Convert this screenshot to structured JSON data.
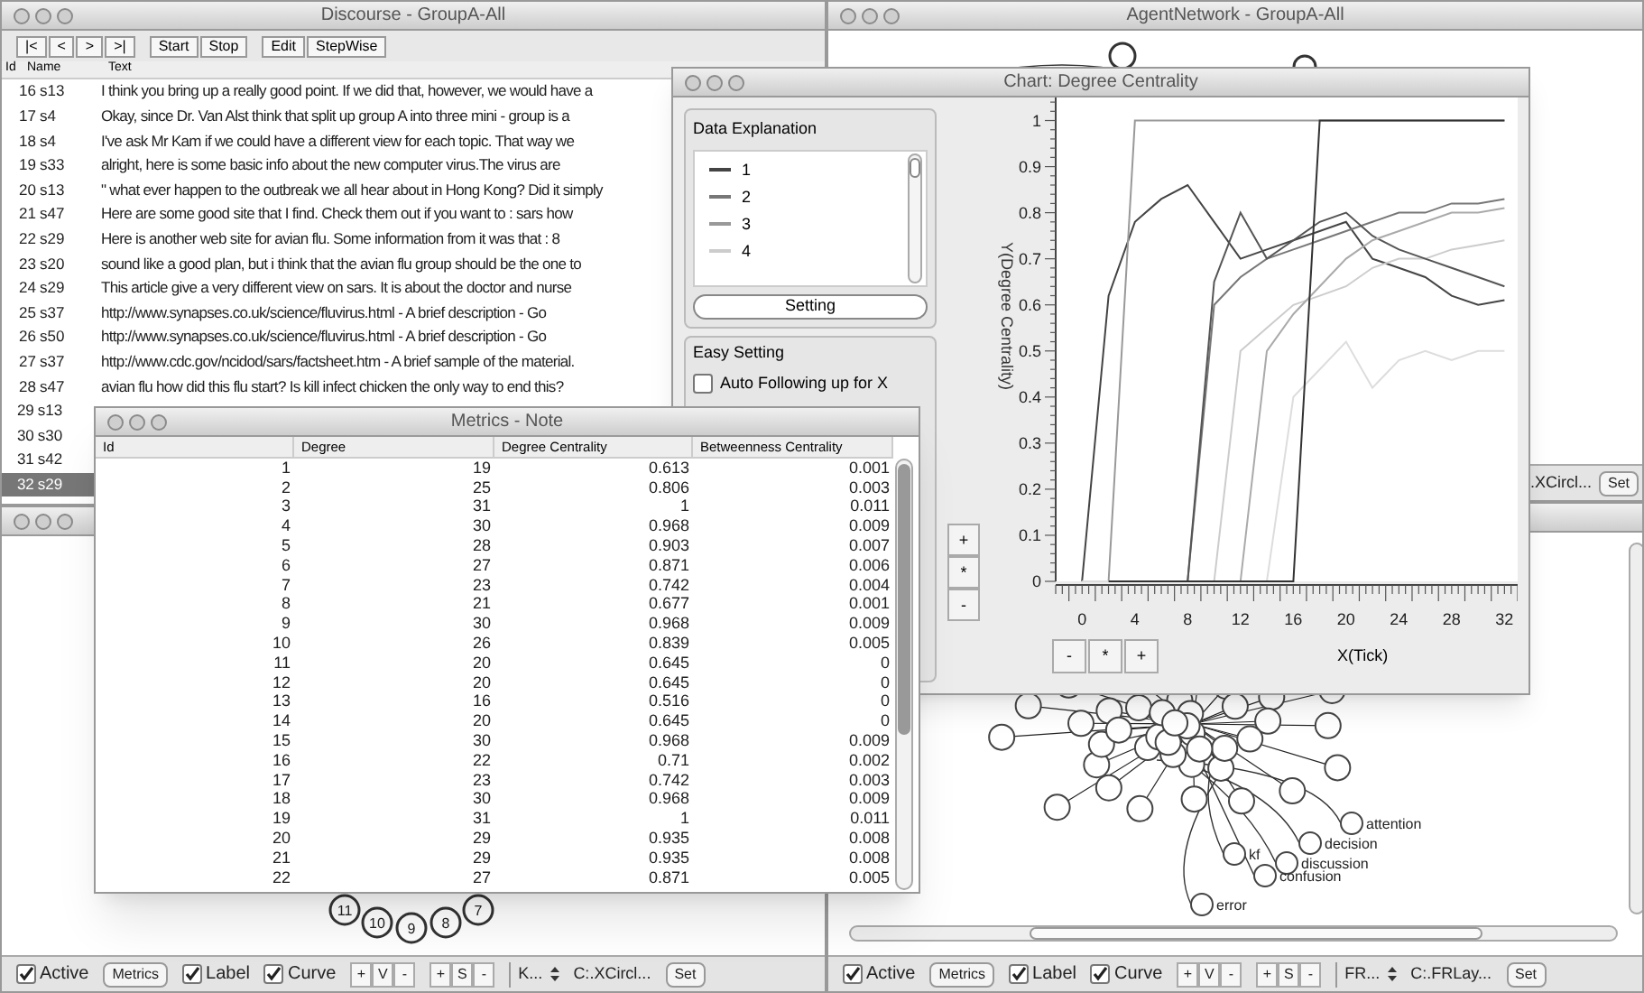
{
  "discourse": {
    "title": "Discourse - GroupA-All",
    "toolbar_groups": [
      [
        "|<",
        "<",
        ">",
        ">|"
      ],
      [
        "Start",
        "Stop"
      ],
      [
        "Edit",
        "StepWise"
      ]
    ],
    "columns": [
      "Id",
      "Name",
      "Text"
    ],
    "rows": [
      {
        "id": "16",
        "name": "s13",
        "text": "I think you bring up a really good point. If we did that, however, we would have a",
        "selected": false
      },
      {
        "id": "17",
        "name": "s4",
        "text": "Okay, since Dr. Van Alst think that split up group A into three mini - group is a",
        "selected": false
      },
      {
        "id": "18",
        "name": "s4",
        "text": "I've ask Mr Kam if we could have a different view for each topic. That way we",
        "selected": false
      },
      {
        "id": "19",
        "name": "s33",
        "text": "alright, here is some basic info about the new computer virus.The virus are",
        "selected": false
      },
      {
        "id": "20",
        "name": "s13",
        "text": "\" what ever happen to the outbreak we all hear about in Hong Kong? Did it simply",
        "selected": false
      },
      {
        "id": "21",
        "name": "s47",
        "text": "Here are some good site that I find. Check them out if you want to : sars how",
        "selected": false
      },
      {
        "id": "22",
        "name": "s29",
        "text": "Here is another web site for avian flu. Some information from it was that : 8",
        "selected": false
      },
      {
        "id": "23",
        "name": "s20",
        "text": "sound like a good plan, but i think that the avian flu group should be  the one to",
        "selected": false
      },
      {
        "id": "24",
        "name": "s29",
        "text": "This article give a very different view on sars. It is about the doctor and nurse",
        "selected": false
      },
      {
        "id": "25",
        "name": "s37",
        "text": "http://www.synapses.co.uk/science/fluvirus.html - A brief description  - Go",
        "selected": false
      },
      {
        "id": "26",
        "name": "s50",
        "text": "http://www.synapses.co.uk/science/fluvirus.html - A brief description  - Go",
        "selected": false
      },
      {
        "id": "27",
        "name": "s37",
        "text": "http://www.cdc.gov/ncidod/sars/factsheet.htm - A brief sample of the material.",
        "selected": false
      },
      {
        "id": "28",
        "name": "s47",
        "text": "avian flu how did this flu start? Is kill infect chicken the only way to end this?",
        "selected": false
      },
      {
        "id": "29",
        "name": "s13",
        "selected": false
      },
      {
        "id": "30",
        "name": "s30",
        "selected": false
      },
      {
        "id": "31",
        "name": "s42",
        "selected": false
      },
      {
        "id": "32",
        "name": "s29",
        "selected": true
      }
    ]
  },
  "left_network": {
    "node_labels": [
      "11",
      "10",
      "9",
      "8",
      "7"
    ],
    "toolbar": [
      {
        "kind": "checkbox",
        "label": "Active",
        "checked": true
      },
      {
        "kind": "button",
        "label": "Metrics"
      },
      {
        "kind": "checkbox",
        "label": "Label",
        "checked": true
      },
      {
        "kind": "checkbox",
        "label": "Curve",
        "checked": true
      },
      {
        "kind": "stepper",
        "parts": [
          "+",
          "V",
          "-"
        ]
      },
      {
        "kind": "stepper",
        "parts": [
          "+",
          "S",
          "-"
        ]
      },
      {
        "kind": "select",
        "label": "K..."
      },
      {
        "kind": "text",
        "label": "C:.XCircl..."
      },
      {
        "kind": "button",
        "label": "Set"
      }
    ]
  },
  "agent_network": {
    "title": "AgentNetwork - GroupA-All",
    "toolbar": [
      {
        "kind": "text",
        "label": ".XCircl..."
      },
      {
        "kind": "button",
        "label": "Set"
      }
    ]
  },
  "right_network": {
    "node_labels": [
      "attention",
      "decision",
      "discussion",
      "confusion",
      "kf",
      "error"
    ],
    "toolbar": [
      {
        "kind": "checkbox",
        "label": "Active",
        "checked": true
      },
      {
        "kind": "button",
        "label": "Metrics"
      },
      {
        "kind": "checkbox",
        "label": "Label",
        "checked": true
      },
      {
        "kind": "checkbox",
        "label": "Curve",
        "checked": true
      },
      {
        "kind": "stepper",
        "parts": [
          "+",
          "V",
          "-"
        ]
      },
      {
        "kind": "stepper",
        "parts": [
          "+",
          "S",
          "-"
        ]
      },
      {
        "kind": "select",
        "label": "FR..."
      },
      {
        "kind": "text",
        "label": "C:.FRLay..."
      },
      {
        "kind": "button",
        "label": "Set"
      }
    ]
  },
  "chart_window": {
    "title": "Chart: Degree Centrality",
    "data_explanation": {
      "title": "Data Explanation",
      "items": [
        {
          "label": "1",
          "color": "#444444"
        },
        {
          "label": "2",
          "color": "#777777"
        },
        {
          "label": "3",
          "color": "#999999"
        },
        {
          "label": "4",
          "color": "#cccccc"
        }
      ],
      "button": "Setting"
    },
    "easy_setting": {
      "title": "Easy Setting",
      "checkbox": {
        "label": "Auto Following up for X",
        "checked": false
      }
    },
    "y_buttons": [
      "+",
      "*",
      "-"
    ],
    "x_buttons": [
      "-",
      "*",
      "+"
    ],
    "chart_data": {
      "type": "line",
      "xlabel": "X(Tick)",
      "ylabel": "Y(Degree Centrality)",
      "x": [
        0,
        2,
        4,
        6,
        8,
        10,
        12,
        14,
        16,
        18,
        20,
        22,
        24,
        26,
        28,
        30,
        32
      ],
      "xlim": [
        -2,
        33
      ],
      "ylim": [
        0,
        1.05
      ],
      "xticks": [
        0,
        4,
        8,
        12,
        16,
        20,
        24,
        28,
        32
      ],
      "yticks": [
        {
          "value": 0,
          "label": "0"
        },
        {
          "value": 0.1,
          "label": "0.1"
        },
        {
          "value": 0.2,
          "label": "0.2"
        },
        {
          "value": 0.3,
          "label": "0.3"
        },
        {
          "value": 0.4,
          "label": "0.4"
        },
        {
          "value": 0.5,
          "label": "0.5"
        },
        {
          "value": 0.6,
          "label": "0.6"
        },
        {
          "value": 0.7,
          "label": "0.7"
        },
        {
          "value": 0.8,
          "label": "0.8"
        },
        {
          "value": 0.9,
          "label": "0.9"
        },
        {
          "value": 1,
          "label": "1"
        }
      ],
      "series": [
        {
          "color": "#444444",
          "values": [
            0,
            0.62,
            0.78,
            0.83,
            0.86,
            0.78,
            0.7,
            0.72,
            0.74,
            0.76,
            0.78,
            0.7,
            0.68,
            0.66,
            0.62,
            0.6,
            0.61
          ]
        },
        {
          "color": "#777777",
          "values": [
            0,
            0,
            0,
            0,
            0,
            0.6,
            0.66,
            0.7,
            0.72,
            0.74,
            0.76,
            0.78,
            0.8,
            0.8,
            0.82,
            0.82,
            0.83
          ]
        },
        {
          "color": "#999999",
          "values": [
            0,
            0,
            1,
            1,
            1,
            1,
            1,
            1,
            1,
            1,
            1,
            1,
            1,
            1,
            1,
            1,
            1
          ]
        },
        {
          "color": "#cccccc",
          "values": [
            0,
            0,
            0,
            0,
            0,
            0,
            0.5,
            0.55,
            0.6,
            0.62,
            0.64,
            0.68,
            0.7,
            0.7,
            0.72,
            0.73,
            0.74
          ]
        },
        {
          "color": "#555555",
          "values": [
            0,
            0,
            0,
            0,
            0,
            0.65,
            0.8,
            0.7,
            0.74,
            0.78,
            0.8,
            0.75,
            0.72,
            0.7,
            0.68,
            0.66,
            0.64
          ]
        },
        {
          "color": "#aaaaaa",
          "values": [
            0,
            0,
            0,
            0,
            0,
            0,
            0,
            0.5,
            0.58,
            0.64,
            0.7,
            0.74,
            0.76,
            0.78,
            0.8,
            0.8,
            0.81
          ]
        },
        {
          "color": "#dddddd",
          "values": [
            0,
            0,
            0,
            0,
            0,
            0,
            0,
            0,
            0.4,
            0.46,
            0.52,
            0.42,
            0.48,
            0.5,
            0.48,
            0.5,
            0.5
          ]
        },
        {
          "color": "#333333",
          "values": [
            null,
            0,
            0,
            0,
            0,
            0,
            0,
            0,
            0,
            1,
            1,
            1,
            1,
            1,
            1,
            1,
            1
          ]
        }
      ]
    }
  },
  "metrics": {
    "title": "Metrics - Note",
    "columns": [
      "Id",
      "Degree",
      "Degree Centrality",
      "Betweenness Centrality"
    ],
    "rows": [
      [
        "1",
        "19",
        "0.613",
        "0.001"
      ],
      [
        "2",
        "25",
        "0.806",
        "0.003"
      ],
      [
        "3",
        "31",
        "1",
        "0.011"
      ],
      [
        "4",
        "30",
        "0.968",
        "0.009"
      ],
      [
        "5",
        "28",
        "0.903",
        "0.007"
      ],
      [
        "6",
        "27",
        "0.871",
        "0.006"
      ],
      [
        "7",
        "23",
        "0.742",
        "0.004"
      ],
      [
        "8",
        "21",
        "0.677",
        "0.001"
      ],
      [
        "9",
        "30",
        "0.968",
        "0.009"
      ],
      [
        "10",
        "26",
        "0.839",
        "0.005"
      ],
      [
        "11",
        "20",
        "0.645",
        "0"
      ],
      [
        "12",
        "20",
        "0.645",
        "0"
      ],
      [
        "13",
        "16",
        "0.516",
        "0"
      ],
      [
        "14",
        "20",
        "0.645",
        "0"
      ],
      [
        "15",
        "30",
        "0.968",
        "0.009"
      ],
      [
        "16",
        "22",
        "0.71",
        "0.002"
      ],
      [
        "17",
        "23",
        "0.742",
        "0.003"
      ],
      [
        "18",
        "30",
        "0.968",
        "0.009"
      ],
      [
        "19",
        "31",
        "1",
        "0.011"
      ],
      [
        "20",
        "29",
        "0.935",
        "0.008"
      ],
      [
        "21",
        "29",
        "0.935",
        "0.008"
      ],
      [
        "22",
        "27",
        "0.871",
        "0.005"
      ]
    ]
  }
}
